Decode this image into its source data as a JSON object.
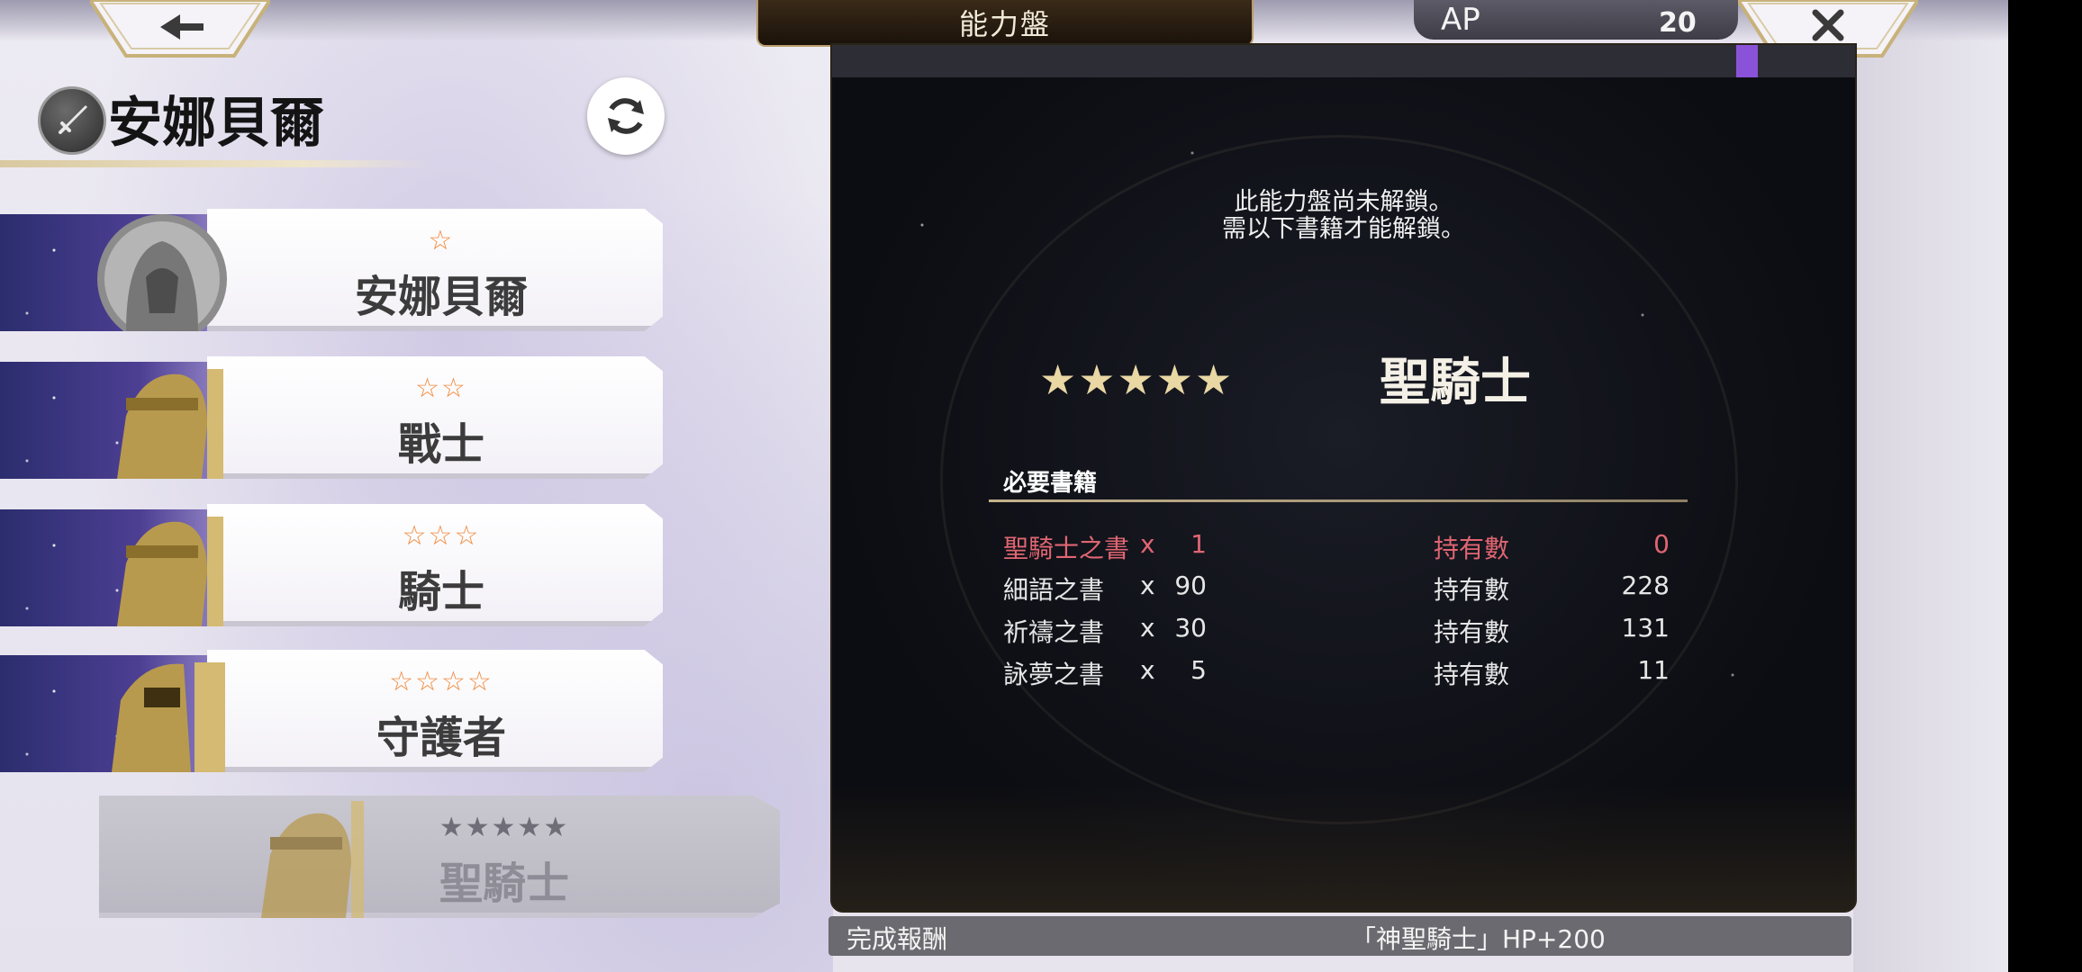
{
  "header": {
    "title": "能力盤",
    "ap_label": "AP",
    "ap_value": "20"
  },
  "character": {
    "name": "安娜貝爾"
  },
  "jobs": [
    {
      "stars": "☆",
      "name": "安娜貝爾",
      "locked": false
    },
    {
      "stars": "☆☆",
      "name": "戰士",
      "locked": false
    },
    {
      "stars": "☆☆☆",
      "name": "騎士",
      "locked": false
    },
    {
      "stars": "☆☆☆☆",
      "name": "守護者",
      "locked": false
    },
    {
      "stars": "★★★★★",
      "name": "聖騎士",
      "locked": true
    }
  ],
  "detail": {
    "lock_message_line1": "此能力盤尚未解鎖。",
    "lock_message_line2": "需以下書籍才能解鎖。",
    "job_stars": "★★★★★",
    "job_title": "聖騎士",
    "required_books_heading": "必要書籍",
    "books": [
      {
        "name": "聖騎士之書",
        "x": "x",
        "qty": "1",
        "owned_label": "持有數",
        "owned": "0",
        "missing": true
      },
      {
        "name": "細語之書",
        "x": "x",
        "qty": "90",
        "owned_label": "持有數",
        "owned": "228",
        "missing": false
      },
      {
        "name": "祈禱之書",
        "x": "x",
        "qty": "30",
        "owned_label": "持有數",
        "owned": "131",
        "missing": false
      },
      {
        "name": "詠夢之書",
        "x": "x",
        "qty": "5",
        "owned_label": "持有數",
        "owned": "11",
        "missing": false
      }
    ]
  },
  "reward": {
    "label": "完成報酬",
    "value": "「神聖騎士」HP+200"
  },
  "icons": {
    "back": "arrow-left-icon",
    "close": "close-icon",
    "refresh": "refresh-icon",
    "char_class": "sword-icon"
  },
  "colors": {
    "star_orange": "#f08a3c",
    "missing_red": "#e06672",
    "gold": "#e9d7a4",
    "ap_purple": "#8a52d8"
  }
}
